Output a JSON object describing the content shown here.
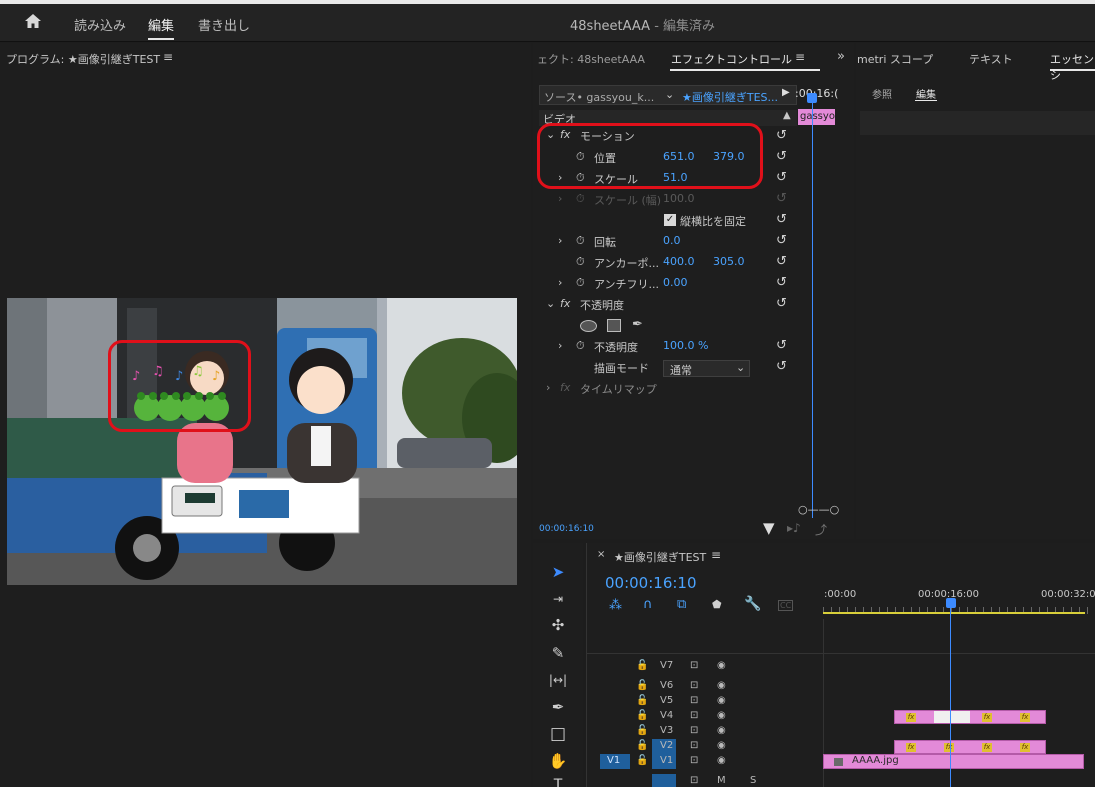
{
  "topbar": {
    "home_label": "⌂",
    "nav": [
      "読み込み",
      "編集",
      "書き出し"
    ],
    "project_name": "48sheetAAA",
    "status": "- 編集済み"
  },
  "program_monitor": {
    "title": "プログラム: ★画像引継ぎTEST",
    "menu": "≡"
  },
  "source_panel": {
    "tabs": [
      "ェクト: 48sheetAAA",
      "エフェクトコントロール",
      "≡",
      "»"
    ],
    "source_label": "ソース• gassyou_k...",
    "sequence_label": "★画像引継ぎTES...",
    "timecode_short": ":00:16:(",
    "clip_name": "gassyo",
    "video_label": "ビデオ",
    "rows": [
      {
        "indent": 0,
        "fx": true,
        "label": "モーション"
      },
      {
        "indent": 1,
        "label": "位置",
        "v1": "651.0",
        "v2": "379.0"
      },
      {
        "indent": 1,
        "label": "スケール",
        "v1": "51.0"
      },
      {
        "indent": 1,
        "label": "スケール (幅)",
        "v1": "100.0",
        "disabled": true
      },
      {
        "indent": 2,
        "label": "縦横比を固定"
      },
      {
        "indent": 1,
        "label": "回転",
        "v1": "0.0"
      },
      {
        "indent": 1,
        "label": "アンカーポ...",
        "v1": "400.0",
        "v2": "305.0"
      },
      {
        "indent": 1,
        "label": "アンチフリ...",
        "v1": "0.00"
      },
      {
        "indent": 0,
        "fx": true,
        "label": "不透明度"
      },
      {
        "indent": 1,
        "label": "不透明度",
        "v1": "100.0 %"
      },
      {
        "indent": 1,
        "label": "描画モード",
        "v1": "通常"
      },
      {
        "indent": 0,
        "fx": true,
        "label": "タイムリマップ"
      }
    ],
    "footer_time": "00:00:16:10"
  },
  "right_panel": {
    "tabs": [
      "metri スコープ",
      "テキスト",
      "エッセンシ"
    ],
    "subtabs": [
      "参照",
      "編集"
    ]
  },
  "timeline": {
    "title": "★画像引継ぎTEST",
    "menu": "≡",
    "timecode": "00:00:16:10",
    "ruler": ":00:00",
    "ruler_mid": "00:00:16:00",
    "ruler_end": "00:00:32:0",
    "tracks": [
      "V7",
      "V6",
      "V5",
      "V4",
      "V3",
      "V2",
      "V1"
    ],
    "source_patch": "V1",
    "clip_name": "AAAA.jpg"
  },
  "colors": {
    "accent": "#4aa3ff",
    "clip": "#e38ad8",
    "highlight": "#e0101a",
    "timecode": "#4aa3ff"
  }
}
